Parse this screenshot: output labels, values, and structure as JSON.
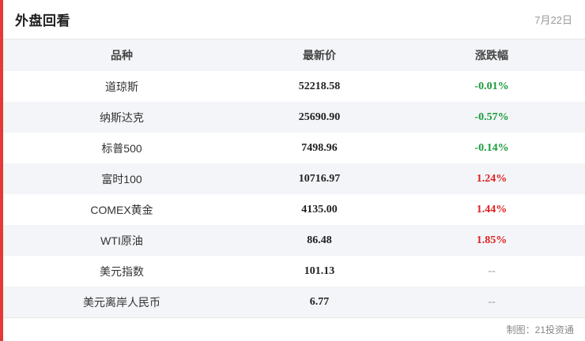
{
  "header": {
    "title": "外盘回看",
    "date": "7月22日"
  },
  "table": {
    "columns": [
      "品种",
      "最新价",
      "涨跌幅"
    ],
    "rows": [
      {
        "name": "道琼斯",
        "price": "52218.58",
        "change": "-0.01%"
      },
      {
        "name": "纳斯达克",
        "price": "25690.90",
        "change": "-0.57%"
      },
      {
        "name": "标普500",
        "price": "7498.96",
        "change": "-0.14%"
      },
      {
        "name": "富时100",
        "price": "10716.97",
        "change": "1.24%"
      },
      {
        "name": "COMEX黄金",
        "price": "4135.00",
        "change": "1.44%"
      },
      {
        "name": "WTI原油",
        "price": "86.48",
        "change": "1.85%"
      },
      {
        "name": "美元指数",
        "price": "101.13",
        "change": "--"
      },
      {
        "name": "美元离岸人民币",
        "price": "6.77",
        "change": "--"
      }
    ]
  },
  "colors": {
    "accent": "#e53935",
    "up": "#e02020",
    "down": "#1a9a3c",
    "neutral": "#999999"
  },
  "footer": {
    "credit": "制图：21投资通"
  }
}
